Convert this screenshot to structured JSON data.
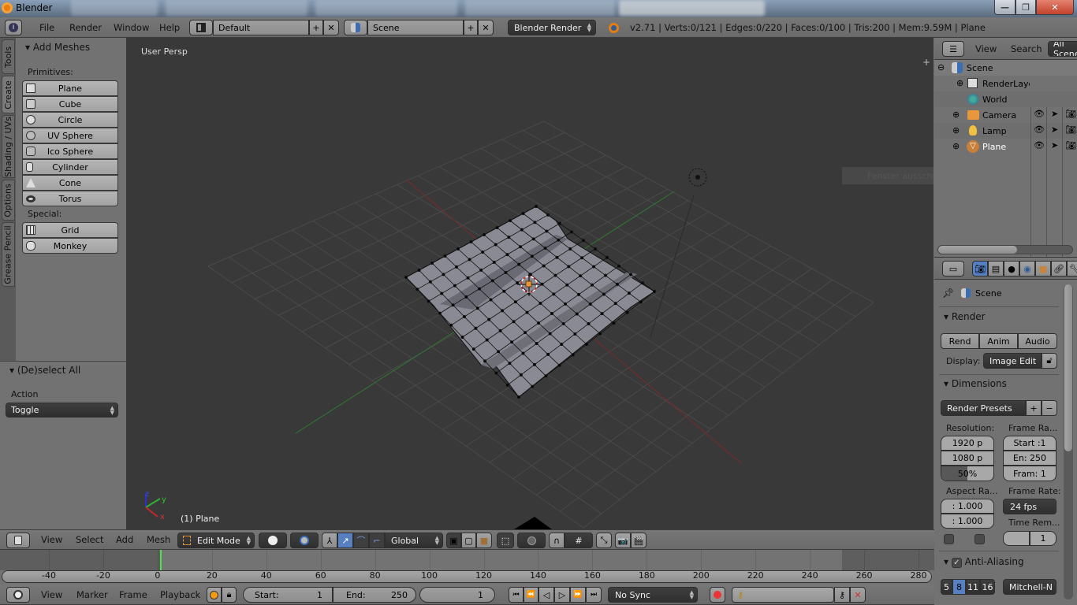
{
  "window": {
    "title": "Blender",
    "controls": [
      "minimize",
      "maximize",
      "close"
    ]
  },
  "info_header": {
    "editor_icon": "info-icon",
    "menus": [
      "File",
      "Render",
      "Window",
      "Help"
    ],
    "layout": {
      "icon": "screen-layout-icon",
      "value": "Default"
    },
    "scene": {
      "icon": "scene-icon",
      "value": "Scene"
    },
    "render_engine": "Blender Render",
    "stats": "v2.71 | Verts:0/121 | Edges:0/220 | Faces:0/100 | Tris:200 | Mem:9.59M | Plane"
  },
  "tool_shelf": {
    "tabs": [
      "Tools",
      "Create",
      "Shading / UVs",
      "Options",
      "Grease Pencil"
    ],
    "active_tab": "Create",
    "panel_title": "Add Meshes",
    "primitives_label": "Primitives:",
    "primitives": [
      "Plane",
      "Cube",
      "Circle",
      "UV Sphere",
      "Ico Sphere",
      "Cylinder",
      "Cone",
      "Torus"
    ],
    "special_label": "Special:",
    "special": [
      "Grid",
      "Monkey"
    ]
  },
  "operator_panel": {
    "title": "(De)select All",
    "action_label": "Action",
    "action_value": "Toggle"
  },
  "viewport": {
    "view_name": "User Persp",
    "object_label": "(1) Plane",
    "axes": [
      "x",
      "y",
      "z"
    ],
    "context_menu_hint": "Fenster ausschneiden"
  },
  "view3d_header": {
    "menus": [
      "View",
      "Select",
      "Add",
      "Mesh"
    ],
    "mode": "Edit Mode",
    "orientation": "Global"
  },
  "outliner": {
    "menus": [
      "View",
      "Search"
    ],
    "filter": "All Scenes",
    "items": [
      {
        "name": "Scene",
        "icon": "scene-icon"
      },
      {
        "name": "RenderLayers",
        "icon": "renderlayers-icon"
      },
      {
        "name": "World",
        "icon": "world-icon"
      },
      {
        "name": "Camera",
        "icon": "camera-icon"
      },
      {
        "name": "Lamp",
        "icon": "lamp-icon"
      },
      {
        "name": "Plane",
        "icon": "mesh-icon"
      }
    ]
  },
  "properties": {
    "context": "Scene",
    "render_panel": {
      "title": "Render",
      "buttons": [
        "Rend",
        "Anim",
        "Audio"
      ],
      "display_label": "Display:",
      "display_value": "Image Edit"
    },
    "dimensions_panel": {
      "title": "Dimensions",
      "presets": "Render Presets",
      "resolution_label": "Resolution:",
      "res_x": "1920 p",
      "res_y": "1080 p",
      "res_percent": "50%",
      "res_percent_value": 0.5,
      "frame_range_label": "Frame Ra...",
      "frame_start": "Start :1",
      "frame_end": "En: 250",
      "frame_step": "Fram: 1",
      "aspect_label": "Aspect Ra...",
      "aspect_x": ": 1.000",
      "aspect_y": ": 1.000",
      "frame_rate_label": "Frame Rate:",
      "frame_rate": "24 fps",
      "time_remap_label": "Time Rem...",
      "time_remap_new": "1"
    },
    "aa_panel": {
      "title": "Anti-Aliasing",
      "checked": true,
      "samples": [
        "5",
        "8",
        "11",
        "16"
      ],
      "active_sample": "8",
      "filter": "Mitchell-N"
    }
  },
  "timeline": {
    "ticks": [
      "-40",
      "-20",
      "0",
      "20",
      "40",
      "60",
      "80",
      "100",
      "120",
      "140",
      "160",
      "180",
      "200",
      "220",
      "240",
      "260",
      "280"
    ],
    "current_frame": 1,
    "menus": [
      "View",
      "Marker",
      "Frame",
      "Playback"
    ],
    "start_label": "Start:",
    "start_value": "1",
    "end_label": "End:",
    "end_value": "250",
    "current_value": "1",
    "sync": "No Sync"
  }
}
